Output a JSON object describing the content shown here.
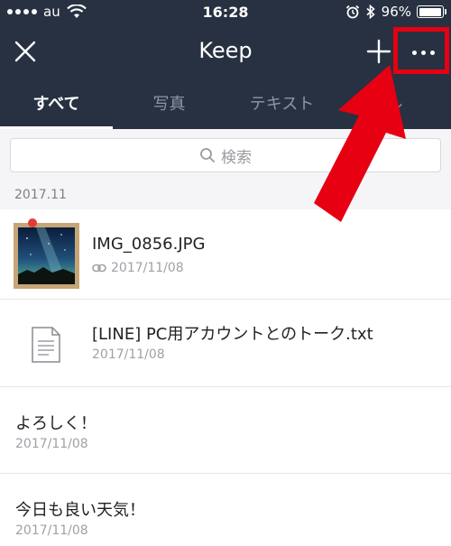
{
  "status_bar": {
    "carrier": "au",
    "time": "16:28",
    "battery_percent": "96%",
    "battery_level": 0.96,
    "alarm_icon": "alarm-clock-icon",
    "bluetooth_icon": "bluetooth-icon",
    "wifi_icon": "wifi-icon"
  },
  "header": {
    "title": "Keep",
    "close_icon": "close-icon",
    "add_icon": "plus-icon",
    "more_icon": "more-dots-icon"
  },
  "tabs": [
    {
      "label": "すべて",
      "active": true
    },
    {
      "label": "写真",
      "active": false
    },
    {
      "label": "テキスト",
      "active": false
    },
    {
      "label": "ル",
      "active": false
    }
  ],
  "search": {
    "placeholder": "検索",
    "icon": "search-icon"
  },
  "section": {
    "label": "2017.11"
  },
  "items": [
    {
      "title": "IMG_0856.JPG",
      "date": "2017/11/08",
      "type": "photo"
    },
    {
      "title": "[LINE] PC用アカウントとのトーク.txt",
      "date": "2017/11/08",
      "type": "file"
    },
    {
      "title": "よろしく！",
      "date": "2017/11/08",
      "type": "text"
    },
    {
      "title": "今日も良い天気！",
      "date": "2017/11/08",
      "type": "text"
    }
  ],
  "colors": {
    "header_bg": "#273142",
    "annotation_red": "#e60012",
    "tab_inactive": "#8d96a6"
  }
}
